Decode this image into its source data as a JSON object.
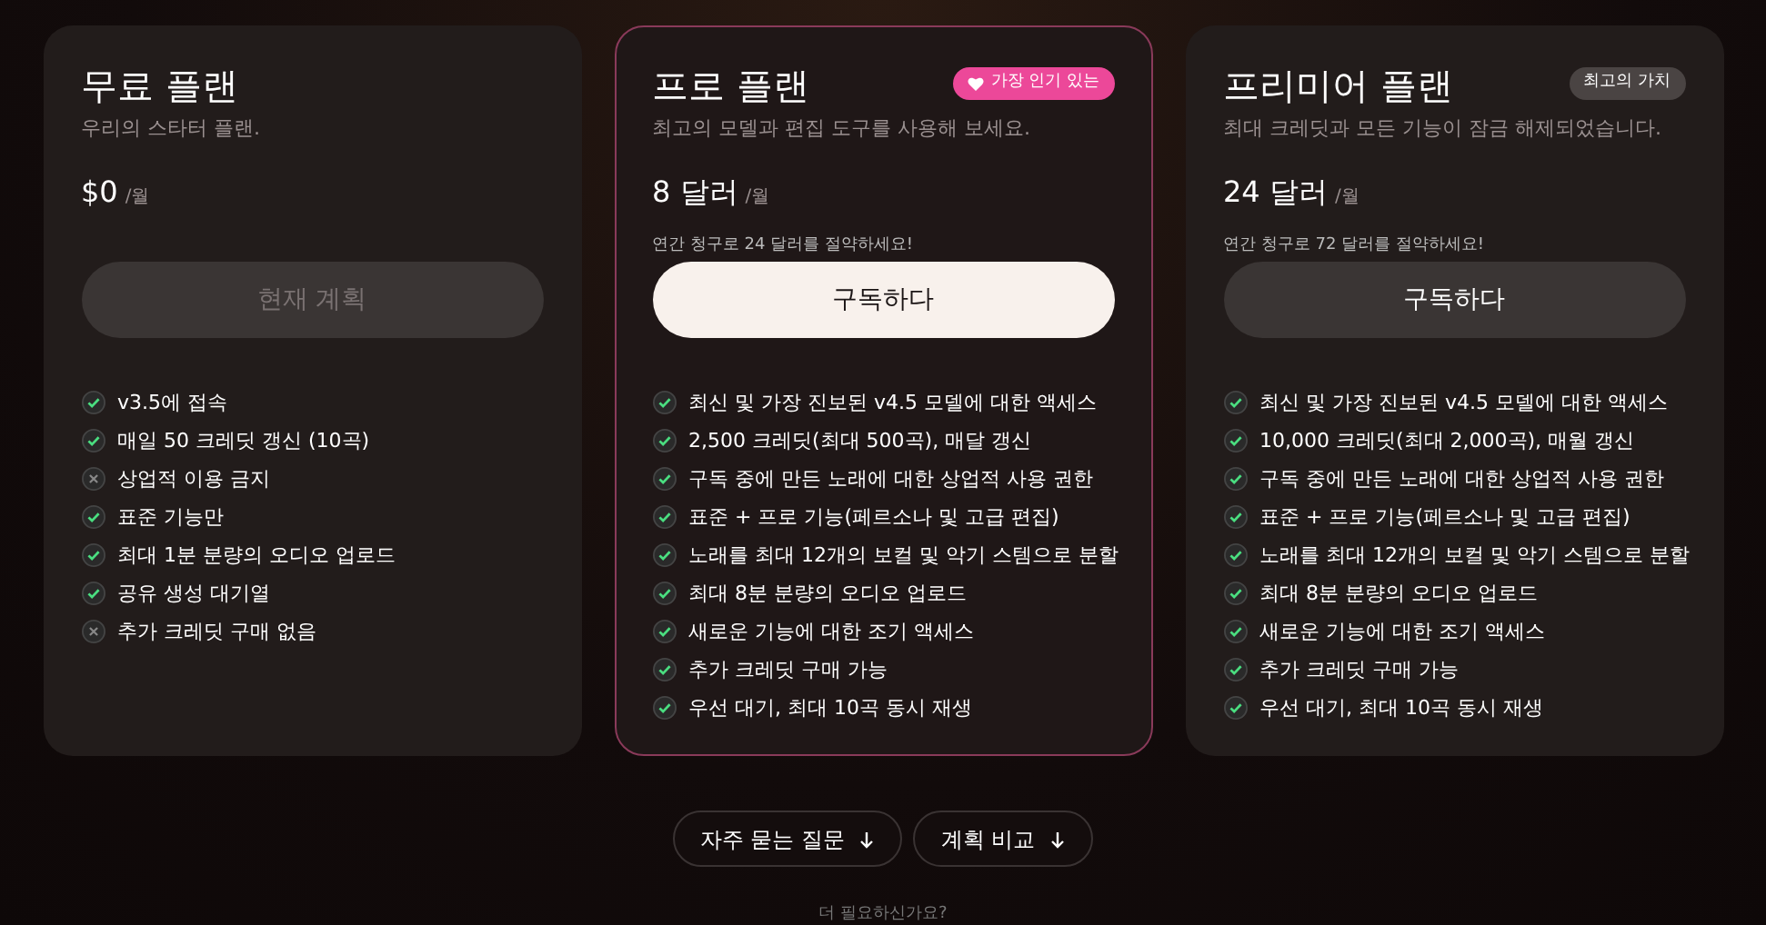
{
  "plans": [
    {
      "name": "무료 플랜",
      "tagline": "우리의 스타터 플랜.",
      "price": "$0",
      "period": "/월",
      "highlighted": false,
      "button": {
        "label": "현재 계획",
        "disabled": true
      },
      "features": [
        {
          "text": "v3.5에 접속",
          "included": true
        },
        {
          "text": "매일 50 크레딧 갱신 (10곡)",
          "included": true
        },
        {
          "text": "상업적 이용 금지",
          "included": false
        },
        {
          "text": "표준 기능만",
          "included": true
        },
        {
          "text": "최대 1분 분량의 오디오 업로드",
          "included": true
        },
        {
          "text": "공유 생성 대기열",
          "included": true
        },
        {
          "text": "추가 크레딧 구매 없음",
          "included": false
        }
      ]
    },
    {
      "name": "프로 플랜",
      "tagline": "최고의 모델과 편집 도구를 사용해 보세요.",
      "price": "8 달러",
      "period": "/월",
      "note": "연간 청구로 24 달러를 절약하세요!",
      "highlighted": true,
      "badge": {
        "kind": "popular",
        "label": "가장 인기 있는"
      },
      "button": {
        "label": "구독하다",
        "disabled": false,
        "kind": "primary"
      },
      "features": [
        {
          "text": "최신 및 가장 진보된 v4.5 모델에 대한 액세스",
          "included": true
        },
        {
          "text": "2,500 크레딧(최대 500곡), 매달 갱신",
          "included": true
        },
        {
          "text": "구독 중에 만든 노래에 대한 상업적 사용 권한",
          "included": true
        },
        {
          "text": "표준 + 프로 기능(페르소나 및 고급 편집)",
          "included": true
        },
        {
          "text": "노래를 최대 12개의 보컬 및 악기 스템으로 분할",
          "included": true
        },
        {
          "text": "최대 8분 분량의 오디오 업로드",
          "included": true
        },
        {
          "text": "새로운 기능에 대한 조기 액세스",
          "included": true
        },
        {
          "text": "추가 크레딧 구매 가능",
          "included": true
        },
        {
          "text": "우선 대기, 최대 10곡 동시 재생",
          "included": true
        }
      ]
    },
    {
      "name": "프리미어 플랜",
      "tagline": "최대 크레딧과 모든 기능이 잠금 해제되었습니다.",
      "price": "24 달러",
      "period": "/월",
      "note": "연간 청구로 72 달러를 절약하세요!",
      "highlighted": false,
      "badge": {
        "kind": "value",
        "label": "최고의 가치"
      },
      "button": {
        "label": "구독하다",
        "disabled": false,
        "kind": "secondary"
      },
      "features": [
        {
          "text": "최신 및 가장 진보된 v4.5 모델에 대한 액세스",
          "included": true
        },
        {
          "text": "10,000 크레딧(최대 2,000곡), 매월 갱신",
          "included": true
        },
        {
          "text": "구독 중에 만든 노래에 대한 상업적 사용 권한",
          "included": true
        },
        {
          "text": "표준 + 프로 기능(페르소나 및 고급 편집)",
          "included": true
        },
        {
          "text": "노래를 최대 12개의 보컬 및 악기 스템으로 분할",
          "included": true
        },
        {
          "text": "최대 8분 분량의 오디오 업로드",
          "included": true
        },
        {
          "text": "새로운 기능에 대한 조기 액세스",
          "included": true
        },
        {
          "text": "추가 크레딧 구매 가능",
          "included": true
        },
        {
          "text": "우선 대기, 최대 10곡 동시 재생",
          "included": true
        }
      ]
    }
  ],
  "links": [
    {
      "label": "자주 묻는 질문"
    },
    {
      "label": "계획 비교"
    }
  ],
  "footer": "더 필요하신가요?"
}
